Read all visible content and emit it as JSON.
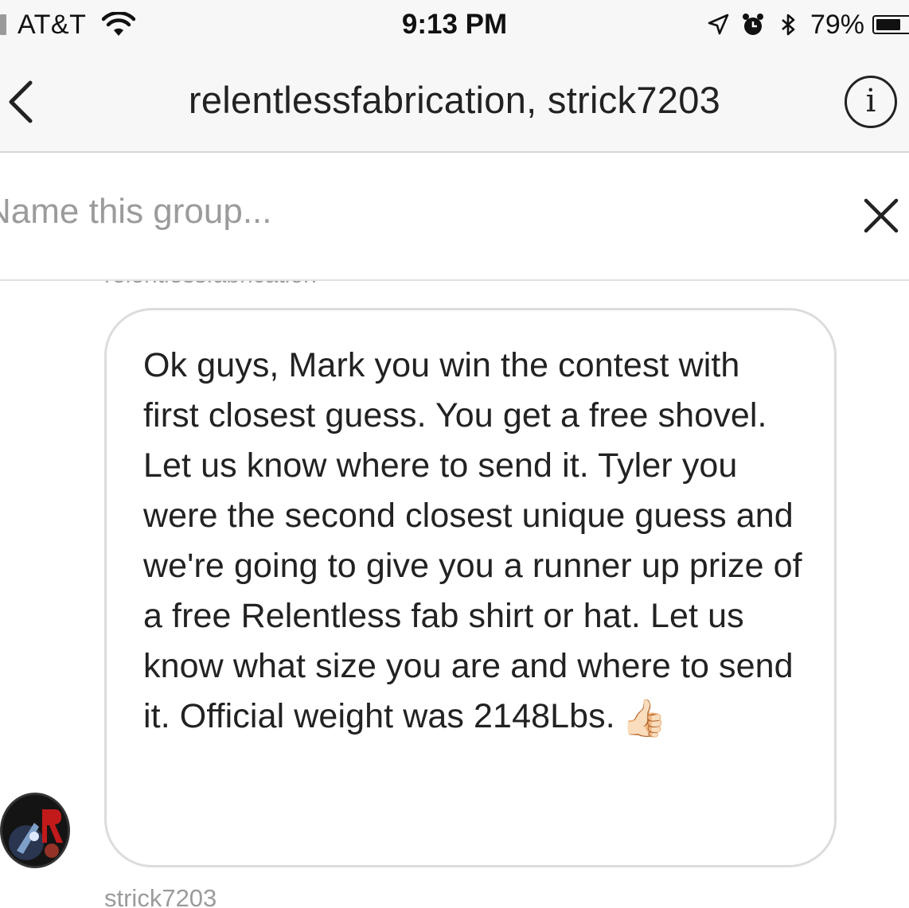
{
  "status_bar": {
    "carrier": "AT&T",
    "time": "9:13 PM",
    "battery_percent": "79%",
    "battery_level": 0.79,
    "icons": [
      "signal-icon",
      "wifi-icon",
      "location-arrow-icon",
      "alarm-icon",
      "bluetooth-icon",
      "battery-icon"
    ]
  },
  "nav": {
    "title": "relentlessfabrication, strick7203",
    "back_icon": "chevron-left-icon",
    "info_icon": "info-icon",
    "info_glyph": "i"
  },
  "group": {
    "placeholder": "Name this group...",
    "value": "",
    "clear_icon": "close-icon"
  },
  "messages": [
    {
      "sender": "relentlessfabrication",
      "text": "Ok guys, Mark you win the contest with first closest guess. You get a free shovel. Let us know where to send it. Tyler you were the second closest unique guess and we're going to give you a runner up prize of a free Relentless fab shirt or hat. Let us know what size you are and where to send it. Official weight was 2148Lbs.",
      "emoji": "👍🏻"
    }
  ],
  "next_sender": "strick7203",
  "colors": {
    "bar_background": "#f7f7f7",
    "divider": "#d6d6d6",
    "bubble_border": "#dcdcdc",
    "muted_text": "#9b9b9b",
    "text": "#222222"
  }
}
